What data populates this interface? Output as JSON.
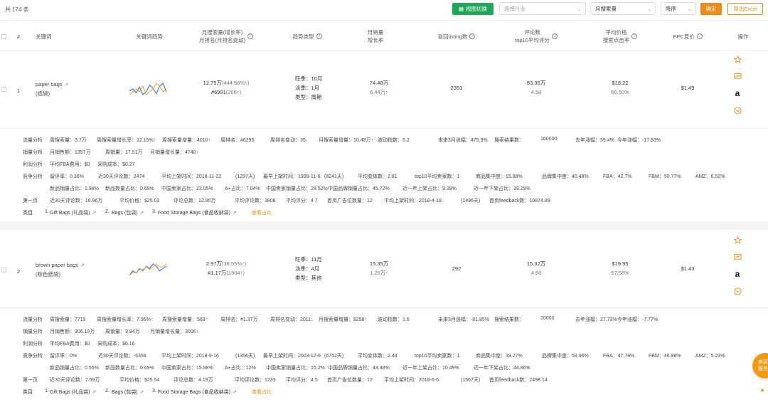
{
  "toolbar": {
    "count": "共 174 条",
    "view_button": "视图切换",
    "filter_placeholder": "选择行业",
    "sort_field": "月搜索量",
    "sort_order": "降序",
    "confirm": "确定",
    "export": "导出Excel"
  },
  "columns": {
    "index": "#",
    "keyword": "关键词",
    "trend": "关键词趋势",
    "search_volume_l1": "月搜索量(增长率)",
    "search_volume_l2": "月排名(月排名变动)",
    "trend_type": "趋势类型",
    "sales_l1": "月销量",
    "sales_l2": "增长率",
    "listing": "返回listing数",
    "reviews_l1": "评论数",
    "reviews_l2": "top10平均评分",
    "price_l1": "平均价格",
    "price_l2": "搜索点击率",
    "ppc": "PPC竞价",
    "action": "操作"
  },
  "rows": [
    {
      "index": "1",
      "keyword_en": "paper bags",
      "keyword_cn": "(纸袋)",
      "volume": "12.75万",
      "volume_growth": "(444.56%",
      "rank": "#6991",
      "rank_change": "(266",
      "peak": "旺季：10月",
      "low": "淡季：1月",
      "type": "类型：周期",
      "sales": "74.48万",
      "sales_growth": "6.44万",
      "listing": "2351",
      "reviews": "83.36万",
      "rating": "4.58",
      "price": "$18.22",
      "ctr": "66.60%",
      "ppc": "$1.49",
      "spark": [
        10,
        12,
        8,
        14,
        6,
        9,
        16,
        13,
        7,
        15,
        18,
        9
      ],
      "spark2": [
        8,
        9,
        10,
        9,
        11,
        8,
        9,
        10,
        12,
        11,
        9,
        10
      ],
      "d1": [
        "流量分析",
        "周搜索量：3.7万",
        "周搜索量增长率：12.15%",
        "周搜索量增量：4010",
        "周排名：#6295",
        "周排名变动：35",
        "月搜索量增量：10.43万",
        "波动指数：5.2",
        "未来3月涨幅：475.9%",
        "搜索结果数：",
        "100000",
        "去年涨幅：59.4%",
        "今年涨幅：-17.93%"
      ],
      "d2": [
        "销量分析",
        "月销售额：1357万",
        "周销量：17.51万",
        "月销量增长量：4740"
      ],
      "d3": [
        "利润分析",
        "平均FBA费用：$0",
        "采购成本：$0.27"
      ],
      "d4": [
        "竞争分析",
        "留评率：0.36%",
        "近30天评论数：2474",
        "平均上架时间：2018-11-22",
        "(1297天)",
        "最早上架时间：1999-11-8",
        "(8241天)",
        "平均变体数：2.81",
        "top10平均卖家数：1",
        "商品集中度：15.88%",
        "品牌集中度：40.48%",
        "FBA：42.7%",
        "FBM：50.77%",
        "AMZ：6.52%"
      ],
      "d5": [
        "新品销量占比：1.98%",
        "新品数量占比：0.69%",
        "中国卖家占比：23.05%",
        "A+占比：7.04%",
        "中国卖家销量占比：28.52%",
        "中国品牌销量占比：45.72%",
        "近一年上架占比：9.39%",
        "近一年下架占比：39.29%"
      ],
      "d6": [
        "第一页",
        "近30天评论数：16.96万",
        "平均价格：$25.03",
        "评论总数：12.85万",
        "平均评论数：3808",
        "平均评分：4.7",
        "首页广告位数量：12",
        "平均上架时间：2018-4-18",
        "(1496天)",
        "首页feedback数：10874.89"
      ],
      "d7": [
        "类目",
        "1.",
        "Gift Bags (礼品袋)",
        "2.",
        "Bags (包袋)",
        "3.",
        "Food Storage Bags (食品收纳袋)",
        "查看占比"
      ]
    },
    {
      "index": "2",
      "keyword_en": "brown paper bags",
      "keyword_cn": "(棕色纸袋)",
      "volume": "2.97万",
      "volume_growth": "(38.55%",
      "rank": "#1.17万",
      "rank_change": "(1804",
      "peak": "旺季：11月",
      "low": "淡季：4月",
      "type": "类型：其他",
      "sales": "15.35万",
      "sales_growth": "1.26万",
      "listing": "292",
      "reviews": "15.32万",
      "rating": "4.66",
      "price": "$19.95",
      "ctr": "57.58%",
      "ppc": "$1.43",
      "spark": [
        8,
        10,
        9,
        11,
        10,
        12,
        11,
        13,
        12,
        10,
        11,
        12
      ],
      "spark2": [
        7,
        8,
        8,
        9,
        9,
        10,
        9,
        10,
        11,
        10,
        10,
        11
      ],
      "d1": [
        "流量分析",
        "周搜索量：7719",
        "周搜索量增长率：7.96%",
        "周搜索量增量：569",
        "周排名：#1.37万",
        "周排名变动：2011",
        "月搜索量增量：8258",
        "波动指数：1.6",
        "未来3月涨幅：-81.85%",
        "搜索结果数：",
        "20000",
        "去年涨幅：27.73%",
        "今年涨幅：-7.77%"
      ],
      "d2": [
        "销量分析",
        "月销售额：306.19万",
        "周销量：3.84万",
        "月销量增长量：3006"
      ],
      "d3": [
        "利润分析",
        "平均FBA费用：$0",
        "采购成本：$0.16"
      ],
      "d4": [
        "竞争分析",
        "留评率：0%",
        "近30天评论数：-6358",
        "平均上架时间：2018-9-16",
        "(1356天)",
        "最早上架时间：2003-12-6",
        "(6752天)",
        "平均变体数：2.44",
        "top10平均卖家数：1",
        "商品集中度：33.27%",
        "品牌集中度：59.96%",
        "FBA：47.78%",
        "FBM：46.98%",
        "AMZ：5.23%"
      ],
      "d5": [
        "新品销量占比：0.55%",
        "新品数量占比：0.69%",
        "中国卖家占比：15.88%",
        "A+占比：12%",
        "中国卖家销量占比：15.2%",
        "中国品牌销量占比：43.48%",
        "近一年上架占比：10.49%",
        "近一年下架占比：44.86%"
      ],
      "d6": [
        "第一页",
        "近30天评论数：7.69万",
        "平均价格：$25.54",
        "评论总数：4.19万",
        "平均评论数：1233",
        "平均评分：4.5",
        "首页广告位数量：12",
        "平均上架时间：2018-6-6",
        "(1567天)",
        "首页feedback数：2498.14"
      ],
      "d7": [
        "类目",
        "1.",
        "Gift Bags (礼品袋)",
        "2.",
        "Bags (包袋)",
        "3.",
        "Food Storage Bags (食品收纳袋)",
        "查看占比"
      ]
    }
  ],
  "float_badge": [
    "卖家",
    "服务"
  ],
  "colors": {
    "green": "#1ea65a",
    "orange": "#f08a10",
    "red": "#e03030",
    "spark_blue": "#4a7fd6",
    "spark_orange": "#f0a030"
  }
}
